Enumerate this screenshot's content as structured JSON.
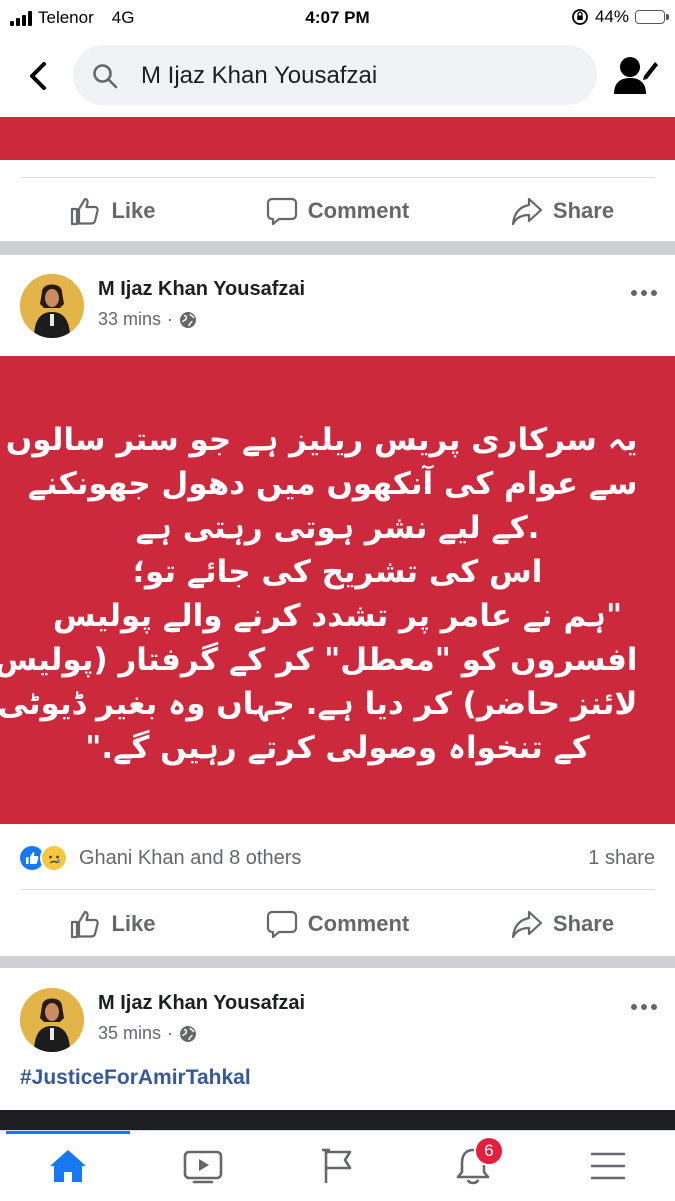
{
  "status_bar": {
    "carrier": "Telenor",
    "network": "4G",
    "time": "4:07 PM",
    "battery_percent": "44%",
    "battery_level": 0.44
  },
  "search": {
    "value": "M Ijaz Khan Yousafzai"
  },
  "post_actions": {
    "like": "Like",
    "comment": "Comment",
    "share": "Share"
  },
  "posts": [
    {
      "author": "M Ijaz Khan Yousafzai",
      "time": "33 mins",
      "separator": "·",
      "audience_icon": "globe-icon",
      "background_color": "#cc2a3c",
      "text_lines": [
        "یہ سرکاری پریس ریلیز ہے جو ستر سالوں",
        "سے عوام کی آنکھوں میں دھول جھونکنے",
        ".کے لیے نشر ہوتی رہتی ہے",
        "اس کی تشریح کی جائے تو؛",
        "\"ہم نے عامر پر تشدد کرنے والے پولیس",
        "افسروں کو \"معطل\" کر کے گرفتار (پولیس",
        "لائنز حاضر) کر دیا ہے. جہاں وہ بغیر ڈیوٹی",
        "کے تنخواہ وصولی کرتے رہیں گے.\""
      ],
      "reactions_text": "Ghani Khan and 8 others",
      "reaction_icons": [
        "like-reaction-icon",
        "sad-reaction-icon"
      ],
      "shares": "1 share"
    },
    {
      "author": "M Ijaz Khan Yousafzai",
      "time": "35 mins",
      "separator": "·",
      "audience_icon": "globe-icon",
      "hashtag": "#JusticeForAmirTahkal"
    }
  ],
  "bottom_nav": {
    "items": [
      "home-icon",
      "watch-icon",
      "pages-icon",
      "notifications-icon",
      "menu-icon"
    ],
    "active": "home-icon",
    "notification_count": "6",
    "accent_color": "#1877f2"
  }
}
